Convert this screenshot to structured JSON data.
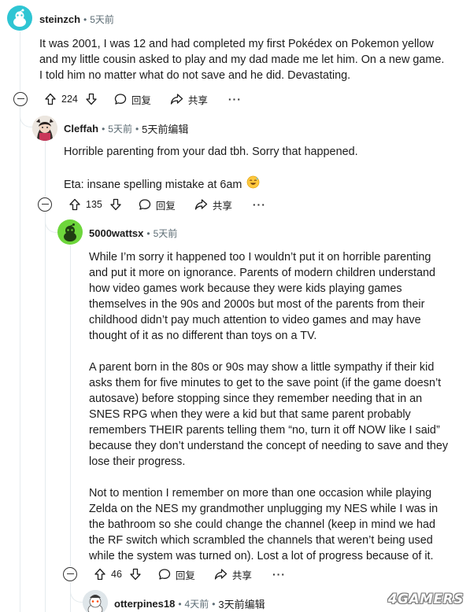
{
  "comments": [
    {
      "author": "steinzch",
      "time": "5天前",
      "edited": "",
      "body": [
        "It was 2001, I was 12 and had completed my first Pokédex on Pokemon yellow and my little cousin asked to play and my dad made me let him. On a new game. I told him no matter what do not save and he did. Devastating."
      ],
      "votes": "224",
      "reply_label": "回复",
      "share_label": "共享",
      "more_label": "···"
    },
    {
      "author": "Cleffah",
      "time": "5天前",
      "edited": "5天前编辑",
      "body": [
        "Horrible parenting from your dad tbh. Sorry that happened.",
        "Eta: insane spelling mistake at 6am"
      ],
      "votes": "135",
      "reply_label": "回复",
      "share_label": "共享",
      "more_label": "···"
    },
    {
      "author": "5000wattsx",
      "time": "5天前",
      "edited": "",
      "body": [
        "While I’m sorry it happened too I wouldn’t put it on horrible parenting and put it more on ignorance. Parents of modern children understand how video games work because they were kids playing games themselves in the 90s and 2000s but most of the parents from their childhood didn’t pay much attention to video games and may have thought of it as no different than toys on a TV.",
        "A parent born in the 80s or 90s may show a little sympathy if their kid asks them for five minutes to get to the save point (if the game doesn’t autosave) before stopping since they remember needing that in an SNES RPG when they were a kid but that same parent probably remembers THEIR parents telling them “no, turn it off NOW like I said” because they don’t understand the concept of needing to save and they lose their progress.",
        "Not to mention I remember on more than one occasion while playing Zelda on the NES my grandmother unplugging my NES while I was in the bathroom so she could change the channel (keep in mind we had the RF switch which scrambled the channels that weren’t being used while the system was turned on). Lost a lot of progress because of it."
      ],
      "votes": "46",
      "reply_label": "回复",
      "share_label": "共享",
      "more_label": "···"
    },
    {
      "author": "otterpines18",
      "time": "4天前",
      "edited": "3天前编辑",
      "body": []
    }
  ],
  "watermark": "4GAMERS",
  "colors": {
    "avatar_steinzch": "#2ec5d3",
    "avatar_5000wattsx": "#6dd63b",
    "thread_line": "#e5ebee",
    "meta_gray": "#5c6c74"
  }
}
